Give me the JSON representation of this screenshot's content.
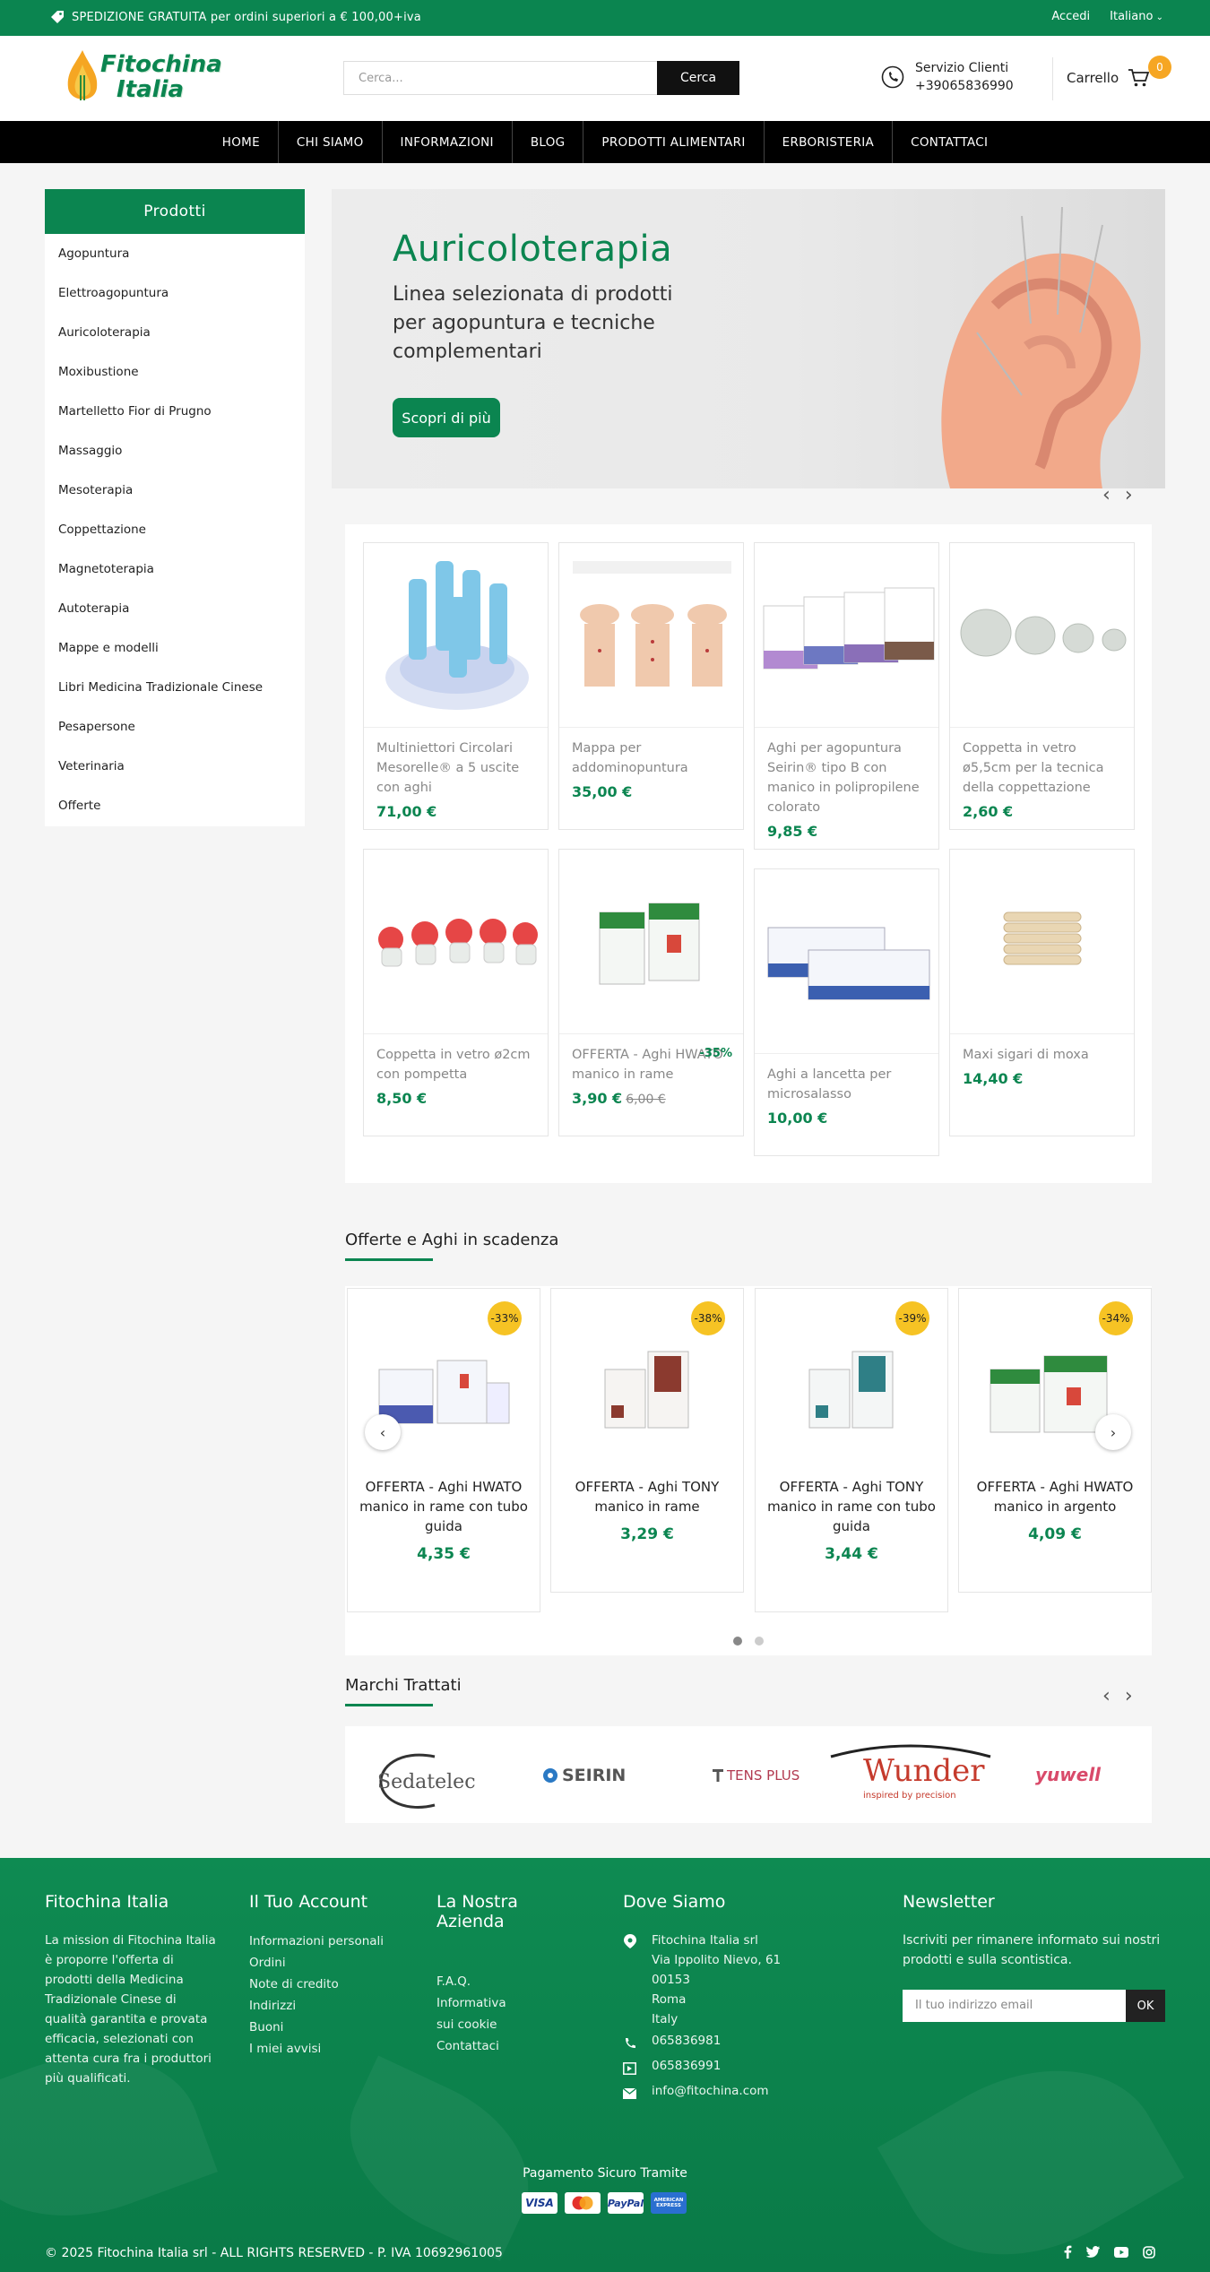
{
  "topbar": {
    "shipping": "SPEDIZIONE GRATUITA per ordini superiori a € 100,00+iva",
    "login": "Accedi",
    "language": "Italiano"
  },
  "header": {
    "logo_line1": "Fitochina",
    "logo_line2": "Italia",
    "search_placeholder": "Cerca...",
    "search_button": "Cerca",
    "service_label": "Servizio Clienti",
    "service_phone": "+39065836990",
    "cart_label": "Carrello",
    "cart_count": "0"
  },
  "nav": [
    "HOME",
    "CHI SIAMO",
    "INFORMAZIONI",
    "BLOG",
    "PRODOTTI ALIMENTARI",
    "ERBORISTERIA",
    "CONTATTACI"
  ],
  "sidebar": {
    "title": "Prodotti",
    "items": [
      "Agopuntura",
      "Elettroagopuntura",
      "Auricoloterapia",
      "Moxibustione",
      "Martelletto Fior di Prugno",
      "Massaggio",
      "Mesoterapia",
      "Coppettazione",
      "Magnetoterapia",
      "Autoterapia",
      "Mappe e modelli",
      "Libri Medicina Tradizionale Cinese",
      "Pesapersone",
      "Veterinaria",
      "Offerte"
    ]
  },
  "banner": {
    "title": "Auricoloterapia",
    "subtitle": "Linea selezionata di prodotti per agopuntura e tecniche complementari",
    "cta": "Scopri di più"
  },
  "products": [
    {
      "name": "Multiniettori Circolari Mesorelle® a 5 uscite con aghi",
      "price": "71,00 €"
    },
    {
      "name": "Mappa per addominopuntura",
      "price": "35,00 €"
    },
    {
      "name": "Aghi per agopuntura Seirin® tipo B con manico in polipropilene colorato",
      "price": "9,85 €"
    },
    {
      "name": "Coppetta in vetro ø5,5cm per la tecnica della coppettazione",
      "price": "2,60 €"
    },
    {
      "name": "Coppetta in vetro ø2cm con pompetta",
      "price": "8,50 €"
    },
    {
      "name": "OFFERTA - Aghi HWATO manico in rame",
      "price": "3,90 €",
      "old_price": "6,00 €",
      "discount": "-35%"
    },
    {
      "name": "Aghi a lancetta per microsalasso",
      "price": "10,00 €"
    },
    {
      "name": "Maxi sigari di moxa",
      "price": "14,40 €"
    }
  ],
  "offers": {
    "title": "Offerte e Aghi in scadenza",
    "items": [
      {
        "name": "OFFERTA - Aghi HWATO manico in rame con tubo guida",
        "price": "4,35 €",
        "discount": "-33%"
      },
      {
        "name": "OFFERTA - Aghi TONY manico in rame",
        "price": "3,29 €",
        "discount": "-38%"
      },
      {
        "name": "OFFERTA - Aghi TONY manico in rame con tubo guida",
        "price": "3,44 €",
        "discount": "-39%"
      },
      {
        "name": "OFFERTA - Aghi HWATO manico in argento",
        "price": "4,09 €",
        "discount": "-34%"
      }
    ]
  },
  "brands": {
    "title": "Marchi Trattati",
    "items": [
      "Sedatelec",
      "SEIRIN",
      "TENS PLUS",
      "Wunder",
      "yuwell"
    ],
    "wunder_tagline": "inspired by precision"
  },
  "footer": {
    "col1": {
      "title": "Fitochina Italia",
      "text": "La mission di Fitochina Italia è proporre l'offerta di prodotti della Medicina Tradizionale Cinese di qualità garantita e provata efficacia, selezionati con attenta cura fra i produttori più qualificati."
    },
    "col2": {
      "title": "Il Tuo Account",
      "links": [
        "Informazioni personali",
        "Ordini",
        "Note di credito",
        "Indirizzi",
        "Buoni",
        "I miei avvisi"
      ]
    },
    "col3": {
      "title": "La Nostra Azienda",
      "links": [
        "F.A.Q.",
        "Informativa sui cookie",
        "Contattaci"
      ]
    },
    "col4": {
      "title": "Dove Siamo",
      "address": "Fitochina Italia srl\nVia Ippolito Nievo, 61\n00153\nRoma\nItaly",
      "phone": "065836981",
      "fax": "065836991",
      "email": "info@fitochina.com"
    },
    "col5": {
      "title": "Newsletter",
      "text": "Iscriviti per rimanere informato sui nostri prodotti e sulla scontistica.",
      "placeholder": "Il tuo indirizzo email",
      "button": "OK"
    },
    "payment_label": "Pagamento Sicuro Tramite",
    "payments": [
      "VISA",
      "Mastercard",
      "PayPal",
      "AMERICAN EXPRESS"
    ],
    "copyright": "© 2025 Fitochina Italia srl - ALL RIGHTS RESERVED - P. IVA 10692961005"
  },
  "colors": {
    "brand_green": "#0b8550",
    "accent_orange": "#f6a623",
    "badge_yellow": "#f6c324"
  }
}
